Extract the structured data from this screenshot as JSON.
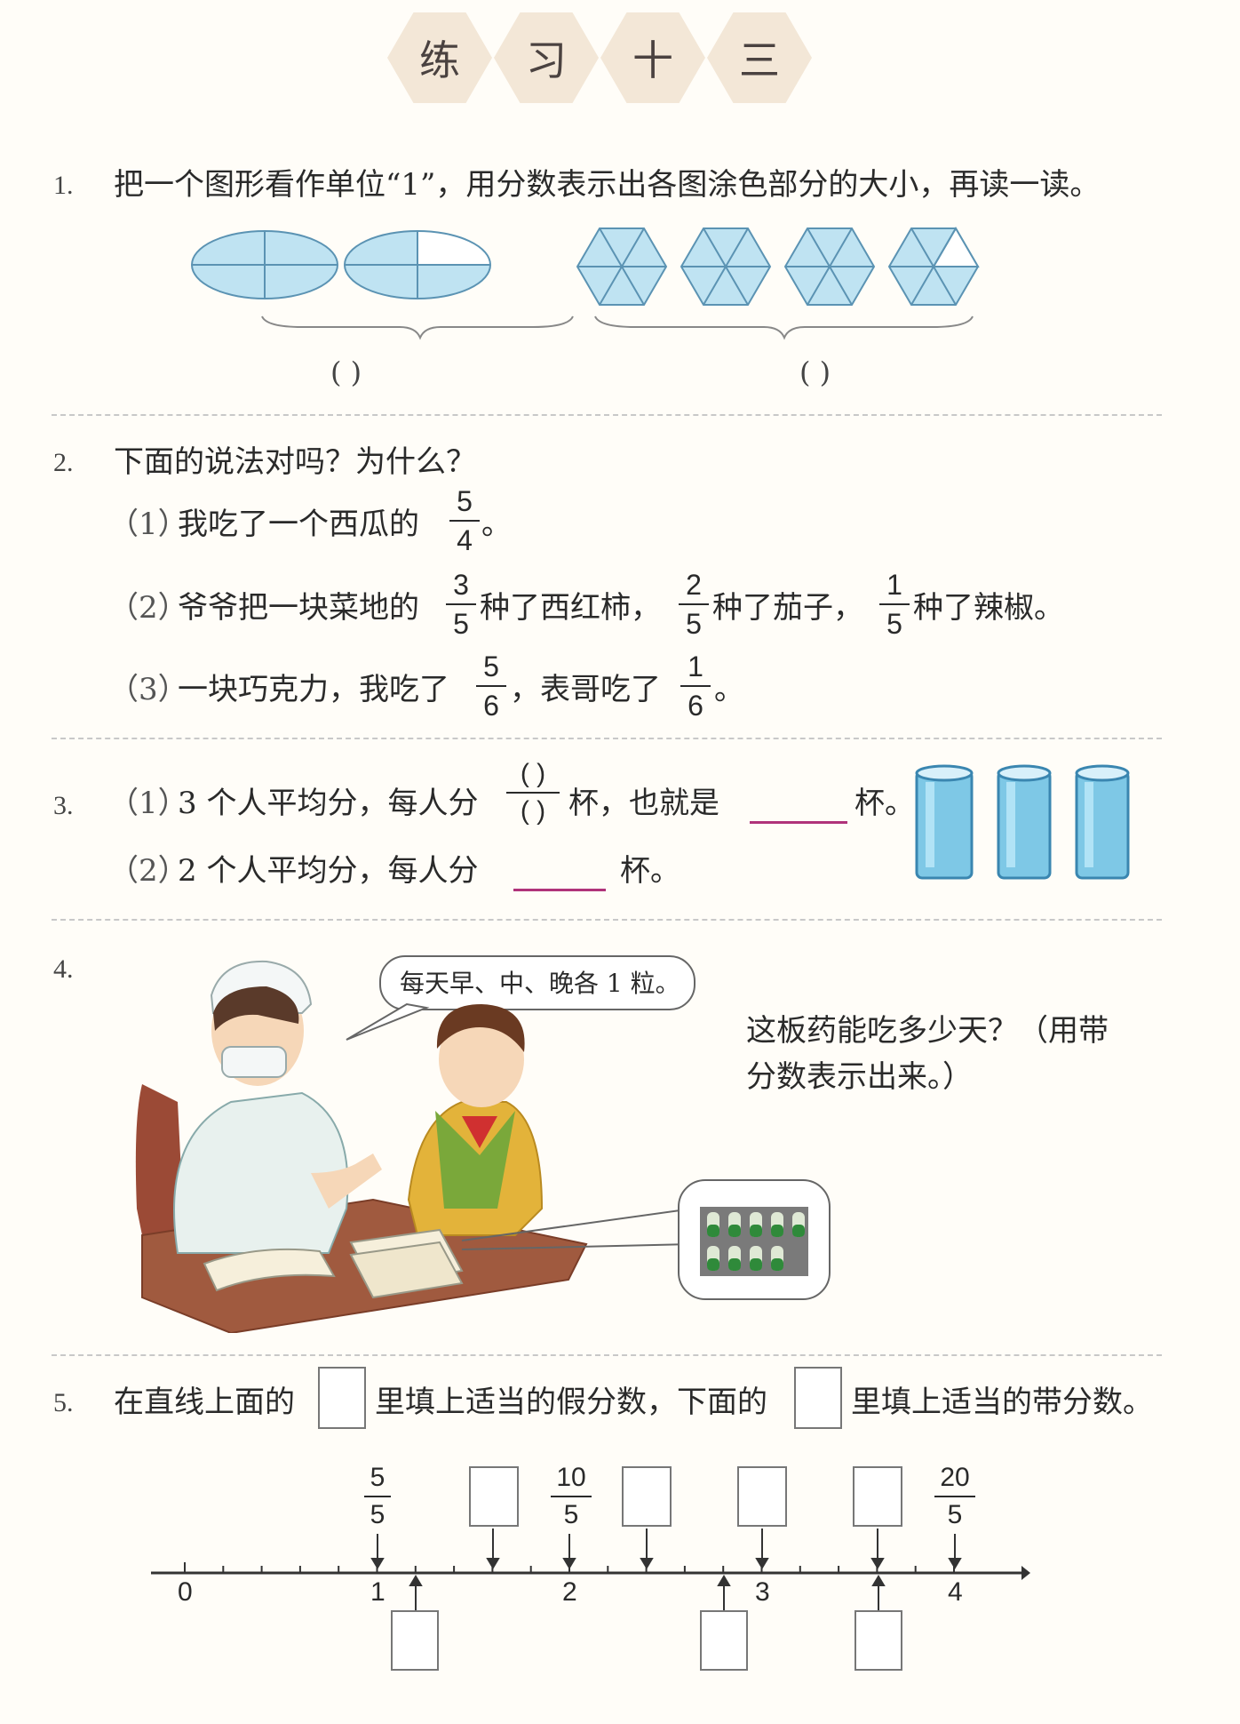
{
  "title_chars": [
    "练",
    "习",
    "十",
    "三"
  ],
  "q1": {
    "num": "1.",
    "text": "把一个图形看作单位“1”，用分数表示出各图涂色部分的大小，再读一读。",
    "answer_left": "(     )",
    "answer_right": "(     )"
  },
  "q2": {
    "num": "2.",
    "text": "下面的说法对吗？为什么？",
    "s1_label": "（1）",
    "s1_text": "我吃了一个西瓜的",
    "s1_frac_n": "5",
    "s1_frac_d": "4",
    "s1_end": "。",
    "s2_label": "（2）",
    "s2_text_a": "爷爷把一块菜地的",
    "s2_f1_n": "3",
    "s2_f1_d": "5",
    "s2_text_b": "种了西红柿，",
    "s2_f2_n": "2",
    "s2_f2_d": "5",
    "s2_text_c": "种了茄子，",
    "s2_f3_n": "1",
    "s2_f3_d": "5",
    "s2_text_d": "种了辣椒。",
    "s3_label": "（3）",
    "s3_text_a": "一块巧克力，我吃了",
    "s3_f1_n": "5",
    "s3_f1_d": "6",
    "s3_text_b": "，表哥吃了",
    "s3_f2_n": "1",
    "s3_f2_d": "6",
    "s3_end": "。"
  },
  "q3": {
    "num": "3.",
    "s1_label": "（1）",
    "s1_text_a": "3 个人平均分，每人分",
    "s1_frac_n": "(  )",
    "s1_frac_d": "(  )",
    "s1_text_b": "杯，也就是",
    "s1_text_c": "杯。",
    "s2_label": "（2）",
    "s2_text_a": "2 个人平均分，每人分",
    "s2_text_b": "杯。"
  },
  "q4": {
    "num": "4.",
    "bubble": "每天早、中、晚各 1 粒。",
    "text_line1": "这板药能吃多少天？（用带",
    "text_line2": "分数表示出来。）"
  },
  "q5": {
    "num": "5.",
    "text_a": "在直线上面的",
    "text_b": "里填上适当的假分数，下面的",
    "text_c": "里填上适当的带分数。",
    "axis_labels": [
      "0",
      "1",
      "2",
      "3",
      "4"
    ],
    "top_fracs": [
      {
        "n": "5",
        "d": "5"
      },
      {
        "n": "10",
        "d": "5"
      },
      {
        "n": "20",
        "d": "5"
      }
    ]
  },
  "colors": {
    "shade": "#bfe3f2",
    "outline": "#5b93b3",
    "magenta": "#b0337a"
  }
}
